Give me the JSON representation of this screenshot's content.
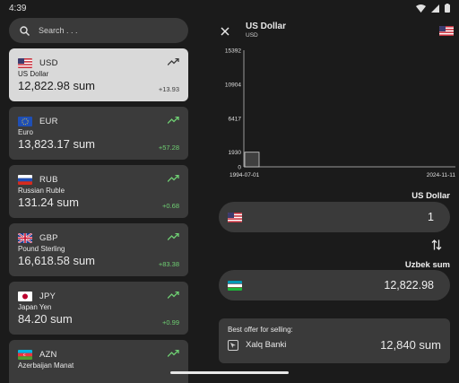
{
  "status_bar": {
    "time": "4:39"
  },
  "search": {
    "placeholder": "Search . . ."
  },
  "currencies": [
    {
      "code": "USD",
      "name": "US Dollar",
      "amount": "12,822.98 sum",
      "delta": "+13.93",
      "selected": true,
      "flag": "us-flag"
    },
    {
      "code": "EUR",
      "name": "Euro",
      "amount": "13,823.17 sum",
      "delta": "+57.28",
      "selected": false,
      "flag": "eu-flag"
    },
    {
      "code": "RUB",
      "name": "Russian Ruble",
      "amount": "131.24 sum",
      "delta": "+0.68",
      "selected": false,
      "flag": "ru-flag"
    },
    {
      "code": "GBP",
      "name": "Pound Sterling",
      "amount": "16,618.58 sum",
      "delta": "+83.38",
      "selected": false,
      "flag": "gb-flag"
    },
    {
      "code": "JPY",
      "name": "Japan Yen",
      "amount": "84.20 sum",
      "delta": "+0.99",
      "selected": false,
      "flag": "jp-flag"
    },
    {
      "code": "AZN",
      "name": "Azerbaijan Manat",
      "amount": "",
      "delta": "",
      "selected": false,
      "flag": "az-flag"
    }
  ],
  "detail": {
    "title": "US Dollar",
    "subtitle": "USD",
    "from_label": "US Dollar",
    "from_value": "1",
    "to_label": "Uzbek sum",
    "to_value": "12,822.98",
    "offer_label": "Best offer for selling:",
    "bank_name": "Xalq Banki",
    "offer_value": "12,840 sum"
  },
  "chart_data": {
    "type": "bar",
    "x_labels": [
      "1994-07-01",
      "2024-11-11"
    ],
    "y_ticks": [
      0,
      1930,
      6417,
      10904,
      15392
    ],
    "ylim": [
      0,
      15392
    ],
    "values": [
      1930
    ],
    "grid": false
  },
  "colors": {
    "positive": "#6fcf73",
    "accent": "#d9d9d9"
  }
}
